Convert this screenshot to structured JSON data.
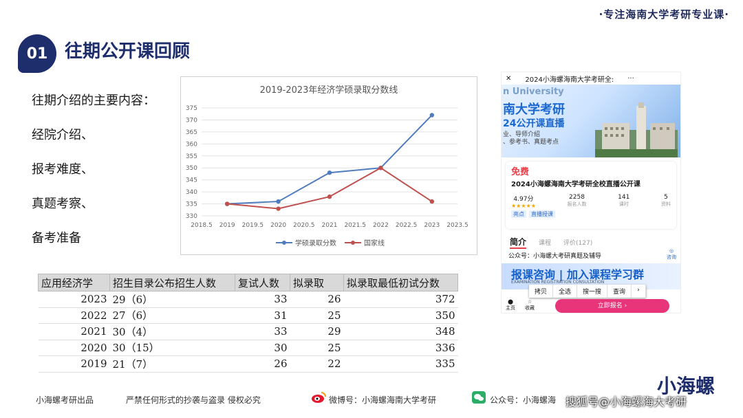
{
  "header": {
    "tagline": "·专注海南大学考研专业课·",
    "section_number": "01",
    "section_title": "往期公开课回顾"
  },
  "intro": {
    "lines": [
      "往期介绍的主要内容：",
      "经院介绍、",
      "报考难度、",
      "真题考察、",
      "备考准备"
    ]
  },
  "chart_data": {
    "type": "line",
    "title": "2019-2023年经济学硕录取分数线",
    "x": [
      2019,
      2020,
      2021,
      2022,
      2023
    ],
    "series": [
      {
        "name": "学硕录取分数",
        "color": "#4f7bbf",
        "values": [
          335,
          336,
          348,
          350,
          372
        ]
      },
      {
        "name": "国家线",
        "color": "#c0504d",
        "values": [
          335,
          333,
          338,
          350,
          336
        ]
      }
    ],
    "xlim": [
      2018.5,
      2023.5
    ],
    "ylim": [
      330,
      375
    ],
    "x_ticks": [
      "2018.5",
      "2019",
      "2019.5",
      "2020",
      "2020.5",
      "2021",
      "2021.5",
      "2022",
      "2022.5",
      "2023",
      "2023.5"
    ],
    "y_ticks": [
      "375",
      "370",
      "365",
      "360",
      "355",
      "350",
      "345",
      "340",
      "335",
      "330"
    ],
    "grid": "horizontal",
    "legend": "bottom"
  },
  "table": {
    "headers": [
      "应用经济学",
      "招生目录公布招生人数",
      "复试人数",
      "拟录取",
      "拟录取最低初试分数"
    ],
    "rows": [
      [
        "2023",
        "29（6）",
        "33",
        "26",
        "372"
      ],
      [
        "2022",
        "27（6）",
        "31",
        "25",
        "350"
      ],
      [
        "2021",
        "30（4）",
        "33",
        "29",
        "348"
      ],
      [
        "2020",
        "30（15）",
        "30",
        "25",
        "336"
      ],
      [
        "2019",
        "21（7）",
        "26",
        "22",
        "335"
      ]
    ]
  },
  "phone": {
    "top_title": "2024小海螺海南大学考研全:",
    "close_glyph": "✕",
    "more_glyph": "···",
    "banner_en": "n University",
    "banner_t1": "南大学考研",
    "banner_t2": "24公开课直播",
    "banner_t3a": "业、导师介绍",
    "banner_t3b": "、参考书、真题考点",
    "free": "免费",
    "course": "2024小海螺海南大学考研全校直播公开课",
    "stats": [
      {
        "value": "4.97分",
        "label": "★★★★★"
      },
      {
        "value": "2258",
        "label": "报名人数"
      },
      {
        "value": "141",
        "label": "课时"
      },
      {
        "value": "5",
        "label": "资料"
      }
    ],
    "tags": [
      "亮点",
      "直播授课"
    ],
    "tabs": [
      "简介",
      "课程",
      "评价(127)"
    ],
    "public_account": "公众号：小海螺大考研真题及辅导",
    "consult": "咨询",
    "ad_main": "报课咨询 | 加入课程学习群",
    "ad_sub": "EXAMINATION REGISTRATION CONSULTATION",
    "menu": [
      "拷贝",
      "全选",
      "搜一搜",
      "查询",
      "›"
    ],
    "bottom": [
      "主页",
      "收藏"
    ],
    "cta": "立即报名 ›"
  },
  "footer": {
    "brand": "小海螺考研出品",
    "copyright": "严禁任何形式的抄袭与盗录   侵权必究",
    "weibo": "微博号：小海螺海南大学考研",
    "wechat": "公众号：小海螺海",
    "watermark": "搜狐号@小海螺海大考研",
    "logo": "小海螺"
  }
}
